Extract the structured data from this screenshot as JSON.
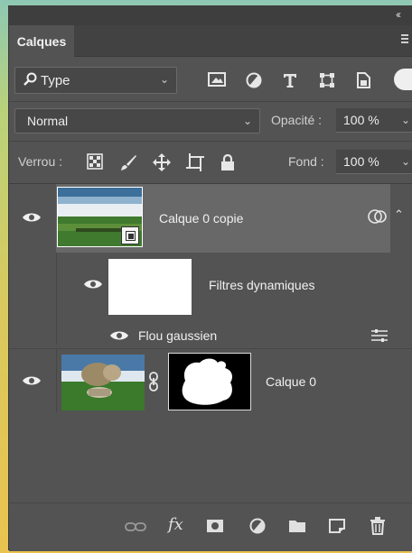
{
  "panel": {
    "tab_label": "Calques",
    "collapse_glyph": "‹‹",
    "filter": {
      "kind_label": "Type"
    },
    "blend_mode": "Normal",
    "opacity": {
      "label": "Opacité :",
      "value": "100 %"
    },
    "lock": {
      "label": "Verrou :"
    },
    "fill": {
      "label": "Fond :",
      "value": "100 %"
    },
    "layers": [
      {
        "name": "Calque 0 copie",
        "selected": true,
        "smart_object": true
      },
      {
        "name": "Filtres dynamiques",
        "type": "smart-filter-mask"
      },
      {
        "name": "Flou gaussien",
        "type": "filter"
      },
      {
        "name": "Calque 0",
        "has_mask": true
      }
    ],
    "bottom_fx_label": "fx"
  },
  "colors": {
    "panel_bg": "#535353",
    "selected_row": "#686868",
    "text": "#f0f0f0"
  }
}
